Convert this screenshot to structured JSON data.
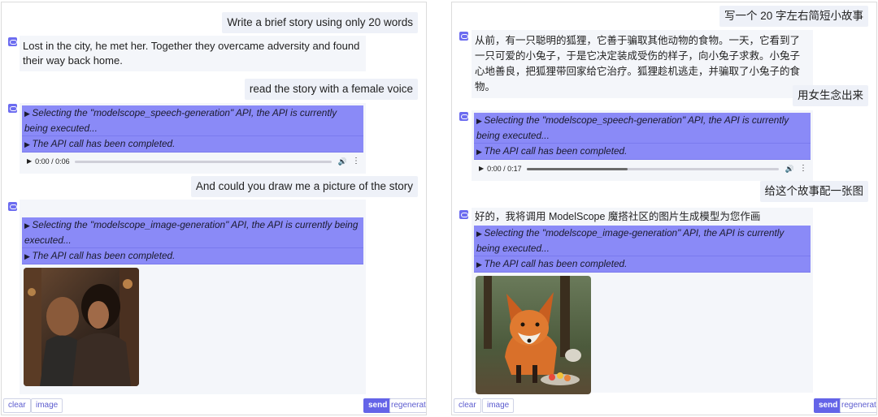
{
  "left_panel": {
    "messages": {
      "user1": "Write a brief story using only 20 words",
      "bot1": "Lost in the city, he met her. Together they overcame adversity and found their way back home.",
      "user2": "read the story with a female voice",
      "user3": "And could you draw me a picture of the story"
    },
    "speech_api": {
      "selecting": "Selecting the \"modelscope_speech-generation\" API, the API is currently being executed...",
      "completed": "The API call has been completed.",
      "audio_time": "0:00 / 0:06",
      "audio_progress": 0
    },
    "image_api": {
      "selecting": "Selecting the \"modelscope_image-generation\" API, the API is currently being executed...",
      "completed": "The API call has been completed."
    }
  },
  "right_panel": {
    "messages": {
      "user1": "写一个 20 字左右简短小故事",
      "bot1": "从前，有一只聪明的狐狸，它善于骗取其他动物的食物。一天，它看到了一只可爱的小兔子，于是它决定装成受伤的样子，向小兔子求救。小兔子心地善良，把狐狸带回家给它治疗。狐狸趁机逃走，并骗取了小兔子的食物。",
      "user2": "用女生念出来",
      "user3": "给这个故事配一张图",
      "bot3": "好的，我将调用 ModelScope 魔搭社区的图片生成模型为您作画"
    },
    "speech_api": {
      "selecting": "Selecting the \"modelscope_speech-generation\" API, the API is currently being executed...",
      "completed": "The API call has been completed.",
      "audio_time": "0:00 / 0:17",
      "audio_progress": 0.4
    },
    "image_api": {
      "selecting": "Selecting the \"modelscope_image-generation\" API, the API is currently being executed...",
      "completed": "The API call has been completed."
    }
  },
  "buttons": {
    "clear": "clear",
    "image": "image",
    "send": "send",
    "regenerate": "regenerate"
  },
  "icons": {
    "bot": "bot-avatar-icon",
    "play": "play-icon",
    "volume": "volume-icon",
    "more": "more-options-icon"
  },
  "colors": {
    "accent": "#6464e8",
    "api_block": "#8a8af7",
    "user_bubble": "#eef1f8",
    "bot_bubble": "#f4f6fa"
  }
}
